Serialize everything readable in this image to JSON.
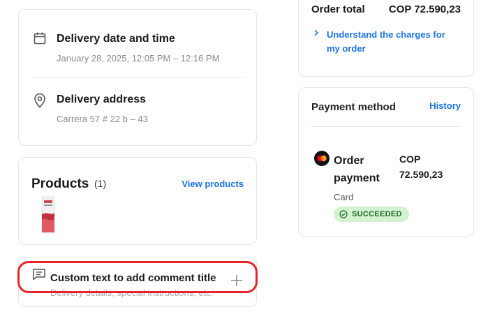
{
  "delivery": {
    "date_title": "Delivery date and time",
    "date_value": "January 28, 2025, 12:05 PM – 12:16 PM",
    "address_title": "Delivery address",
    "address_value": "Carrera 57 # 22 b – 43"
  },
  "products": {
    "title": "Products",
    "count": "(1)",
    "view_link": "View products"
  },
  "comment": {
    "title": "Custom text to add comment title",
    "placeholder": "Delivery details, special instructions, etc."
  },
  "order_total": {
    "label": "Order total",
    "value": "COP 72.590,23",
    "charges_link_line1": "Understand the charges for",
    "charges_link_line2": "my order"
  },
  "payment": {
    "title": "Payment method",
    "history_link": "History",
    "name_line1": "Order",
    "name_line2": "payment",
    "amount_line1": "COP",
    "amount_line2": "72.590,23",
    "method": "Card",
    "status": "SUCCEEDED"
  },
  "colors": {
    "link": "#1a73e8",
    "highlight": "#e8242b",
    "success_bg": "#d3f2d0",
    "success_text": "#1e6b2a"
  },
  "icons": {
    "calendar": "calendar-icon",
    "location": "location-pin-icon",
    "comment": "comment-icon",
    "add": "plus-icon",
    "chevron": "chevron-right-icon",
    "card_brand": "mastercard-icon",
    "status": "check-circle-icon"
  }
}
